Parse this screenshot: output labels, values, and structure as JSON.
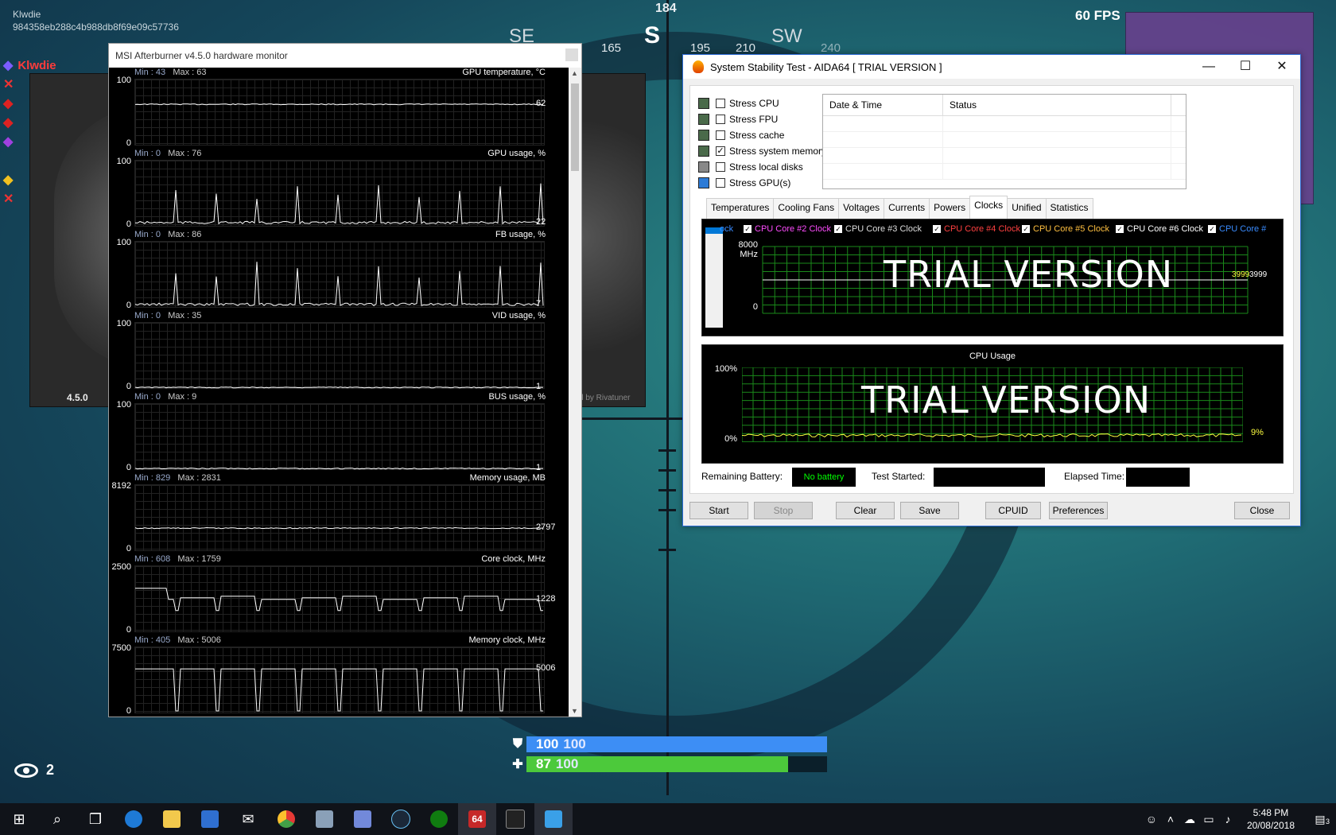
{
  "hud": {
    "user": "Klwdie",
    "hash": "984358eb288c4b988db8f69e09c57736",
    "fps": "60 FPS",
    "compass": {
      "degree": "184",
      "dirs": [
        "SE",
        "S",
        "SW"
      ],
      "nums": [
        "165",
        "195",
        "210",
        "240"
      ]
    },
    "spectators": "2",
    "shield": {
      "value": "100",
      "max": "100",
      "fraction": 1.0,
      "color": "#3d8ef5"
    },
    "health": {
      "value": "87",
      "max": "100",
      "fraction": 0.87,
      "color": "#4cc93b"
    },
    "killfeed_name": "Klwdie",
    "gauge_version": "4.5.0",
    "gauge_brand": "d by Rivatuner"
  },
  "afterburner": {
    "title": "MSI Afterburner v4.5.0 hardware monitor",
    "graphs": [
      {
        "name": "GPU temperature, °C",
        "min_label": "Min : 43",
        "max_label": "Max : 63",
        "top": "100",
        "bottom": "0",
        "current": "62",
        "level": 0.62,
        "pattern": "flat"
      },
      {
        "name": "GPU usage, %",
        "min_label": "Min : 0",
        "max_label": "Max : 76",
        "top": "100",
        "bottom": "0",
        "current": "22",
        "level": 0.05,
        "pattern": "spiky"
      },
      {
        "name": "FB usage, %",
        "min_label": "Min : 0",
        "max_label": "Max : 86",
        "top": "100",
        "bottom": "0",
        "current": "7",
        "level": 0.04,
        "pattern": "spiky"
      },
      {
        "name": "VID usage, %",
        "min_label": "Min : 0",
        "max_label": "Max : 35",
        "top": "100",
        "bottom": "0",
        "current": "1",
        "level": 0.01,
        "pattern": "flat"
      },
      {
        "name": "BUS usage, %",
        "min_label": "Min : 0",
        "max_label": "Max : 9",
        "top": "100",
        "bottom": "0",
        "current": "1",
        "level": 0.01,
        "pattern": "flat"
      },
      {
        "name": "Memory usage, MB",
        "min_label": "Min : 829",
        "max_label": "Max : 2831",
        "top": "8192",
        "bottom": "0",
        "current": "2797",
        "level": 0.34,
        "pattern": "flat"
      },
      {
        "name": "Core clock, MHz",
        "min_label": "Min : 608",
        "max_label": "Max : 1759",
        "top": "2500",
        "bottom": "0",
        "current": "1228",
        "level": 0.49,
        "pattern": "steps"
      },
      {
        "name": "Memory clock, MHz",
        "min_label": "Min : 405",
        "max_label": "Max : 5006",
        "top": "7500",
        "bottom": "0",
        "current": "5006",
        "level": 0.67,
        "pattern": "dips"
      }
    ]
  },
  "aida": {
    "title": "System Stability Test - AIDA64  [ TRIAL VERSION ]",
    "stress_items": [
      {
        "label": "Stress CPU",
        "checked": false
      },
      {
        "label": "Stress FPU",
        "checked": false
      },
      {
        "label": "Stress cache",
        "checked": false
      },
      {
        "label": "Stress system memory",
        "checked": true
      },
      {
        "label": "Stress local disks",
        "checked": false
      },
      {
        "label": "Stress GPU(s)",
        "checked": false
      }
    ],
    "log_headers": [
      "Date & Time",
      "Status"
    ],
    "tabs": [
      "Temperatures",
      "Cooling Fans",
      "Voltages",
      "Currents",
      "Powers",
      "Clocks",
      "Unified",
      "Statistics"
    ],
    "active_tab": "Clocks",
    "clock_legend": [
      {
        "label": "ock",
        "color": "#3a8cff"
      },
      {
        "label": "CPU Core #2 Clock",
        "color": "#ff4cff"
      },
      {
        "label": "CPU Core #3 Clock",
        "color": "#dddddd"
      },
      {
        "label": "CPU Core #4 Clock",
        "color": "#ff4040"
      },
      {
        "label": "CPU Core #5 Clock",
        "color": "#ffc040"
      },
      {
        "label": "CPU Core #6 Clock",
        "color": "#ffffff"
      },
      {
        "label": "CPU Core #",
        "color": "#3a8cff"
      }
    ],
    "clock_chart": {
      "top_label": "8000",
      "unit": "MHz",
      "bottom_label": "0",
      "value_label": "3999",
      "value_label2": "3999",
      "trial": "TRIAL VERSION"
    },
    "cpu_chart": {
      "title": "CPU Usage",
      "top_label": "100%",
      "bottom_label": "0%",
      "value_label": "9%",
      "trial": "TRIAL VERSION"
    },
    "info": {
      "battery_label": "Remaining Battery:",
      "battery_value": "No battery",
      "started_label": "Test Started:",
      "elapsed_label": "Elapsed Time:"
    },
    "buttons": [
      "Start",
      "Stop",
      "Clear",
      "Save",
      "CPUID",
      "Preferences",
      "Close"
    ]
  },
  "taskbar": {
    "time": "5:48 PM",
    "date": "20/08/2018",
    "notification_count": "3"
  }
}
